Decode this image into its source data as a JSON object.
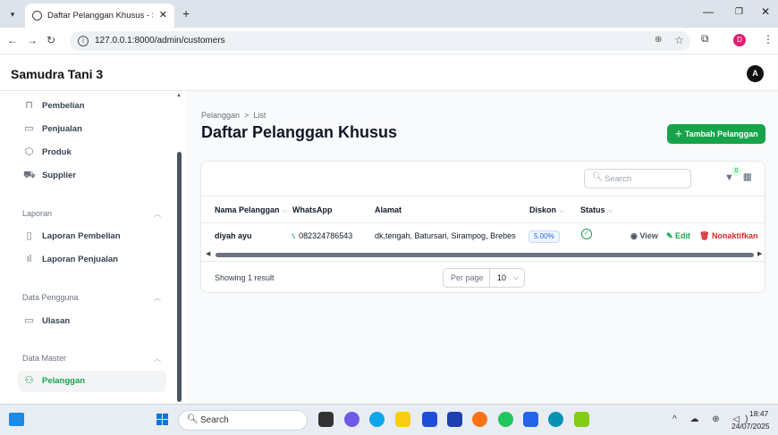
{
  "browser": {
    "tab_title": "Daftar Pelanggan Khusus - Sam",
    "url": "127.0.0.1:8000/admin/customers",
    "profile_initial": "D"
  },
  "app": {
    "brand": "Samudra Tani 3",
    "avatar_initial": "A",
    "accent_color": "#16a34a"
  },
  "sidebar": {
    "top_items": [
      {
        "label": "Pembelian",
        "icon": "shopping-bag-icon"
      },
      {
        "label": "Penjualan",
        "icon": "cash-icon"
      },
      {
        "label": "Produk",
        "icon": "cube-icon"
      },
      {
        "label": "Supplier",
        "icon": "truck-icon"
      }
    ],
    "groups": [
      {
        "label": "Laporan",
        "items": [
          {
            "label": "Laporan Pembelian",
            "icon": "document-icon"
          },
          {
            "label": "Laporan Penjualan",
            "icon": "bar-chart-icon"
          }
        ]
      },
      {
        "label": "Data Pengguna",
        "items": [
          {
            "label": "Ulasan",
            "icon": "chat-icon"
          }
        ]
      },
      {
        "label": "Data Master",
        "items": [
          {
            "label": "Pelanggan",
            "icon": "users-icon",
            "active": true
          }
        ]
      }
    ]
  },
  "page": {
    "breadcrumb_parent": "Pelanggan",
    "breadcrumb_sep": ">",
    "breadcrumb_current": "List",
    "title": "Daftar Pelanggan Khusus",
    "add_button": "Tambah Pelanggan"
  },
  "table": {
    "search_placeholder": "Search",
    "filter_count": "0",
    "columns": [
      {
        "label": "Nama Pelanggan",
        "sortable": true
      },
      {
        "label": "WhatsApp",
        "sortable": false
      },
      {
        "label": "Alamat",
        "sortable": false
      },
      {
        "label": "Diskon",
        "sortable": true
      },
      {
        "label": "Status",
        "sortable": true
      }
    ],
    "rows": [
      {
        "nama": "diyah ayu",
        "whatsapp": "082324786543",
        "alamat": "dk,tengah, Batursari, Sirampog, Brebes",
        "diskon": "5.00%",
        "status": "active",
        "actions": {
          "view": "View",
          "edit": "Edit",
          "deactivate": "Nonaktifkan"
        }
      }
    ],
    "showing": "Showing 1 result",
    "per_page_label": "Per page",
    "per_page_value": "10"
  },
  "taskbar": {
    "search_label": "Search",
    "time": "18:47",
    "date": "24/07/2025"
  }
}
